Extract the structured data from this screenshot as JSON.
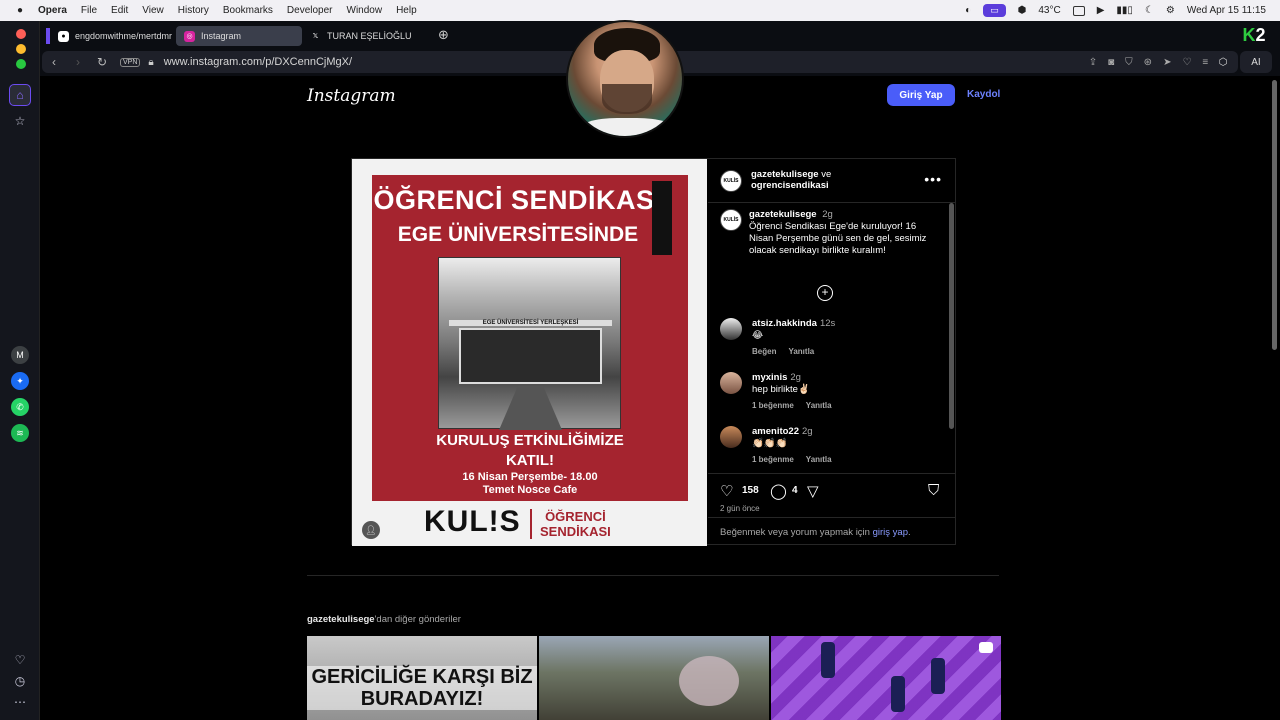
{
  "menubar": {
    "app": "Opera",
    "items": [
      "File",
      "Edit",
      "View",
      "History",
      "Bookmarks",
      "Developer",
      "Window",
      "Help"
    ],
    "temperature": "43°C",
    "datetime": "Wed Apr 15  11:15"
  },
  "tabs": [
    {
      "label": "engdomwithme/mertdmr",
      "icon": "github-icon"
    },
    {
      "label": "Instagram",
      "icon": "instagram-icon",
      "active": true
    },
    {
      "label": "TURAN EŞELİOĞLU",
      "icon": "x-icon"
    }
  ],
  "addressbar": {
    "url": "www.instagram.com/p/DXCennCjMgX/",
    "vpn": "VPN",
    "ai": "AI"
  },
  "instagram": {
    "logo": "Instagram",
    "login_label": "Giriş Yap",
    "signup_label": "Kaydol"
  },
  "post": {
    "poster": {
      "title1": "ÖĞRENCİ SENDİKASI",
      "title2": "EGE ÜNİVERSİTESİNDE",
      "sign": "EGE ÜNİVERSİTESİ YERLEŞKESİ",
      "cta1": "KURULUŞ ETKİNLİĞİMİZE",
      "cta2": "KATIL!",
      "when": "16 Nisan Perşembe- 18.00",
      "where": "Temet Nosce Cafe",
      "brand": "KUL!S",
      "brand2a": "ÖĞRENCİ",
      "brand2b": "SENDİKASI"
    },
    "header": {
      "user1": "gazetekulisege",
      "conj": "ve",
      "user2": "ogrencisendikasi",
      "avatar_text": "KULİS"
    },
    "caption": {
      "user": "gazetekulisege",
      "time": "2g",
      "text": "Öğrenci Sendikası Ege'de kuruluyor! 16 Nisan Perşembe günü sen de gel, sesimiz olacak sendikayı birlikte kuralım!"
    },
    "comments": [
      {
        "user": "atsiz.hakkinda",
        "time": "12s",
        "text": "😂",
        "likes": "Beğen",
        "reply": "Yanıtla"
      },
      {
        "user": "myxinis",
        "time": "2g",
        "text": "hep birlikte✌🏻",
        "likes": "1 beğenme",
        "reply": "Yanıtla"
      },
      {
        "user": "amenito22",
        "time": "2g",
        "text": "👏🏻👏🏻👏🏻",
        "likes": "1 beğenme",
        "reply": "Yanıtla"
      }
    ],
    "likes_count": "158",
    "comments_count": "4",
    "posted_ago": "2 gün önce",
    "login_prompt_pre": "Beğenmek veya yorum yapmak için",
    "login_prompt_link": "giriş yap",
    "login_prompt_post": "."
  },
  "more_posts": {
    "user": "gazetekulisege",
    "suffix": "'dan diğer gönderiler",
    "thumb1_text": "GERİCİLİĞE KARŞI BİZ BURADAYIZ!"
  }
}
